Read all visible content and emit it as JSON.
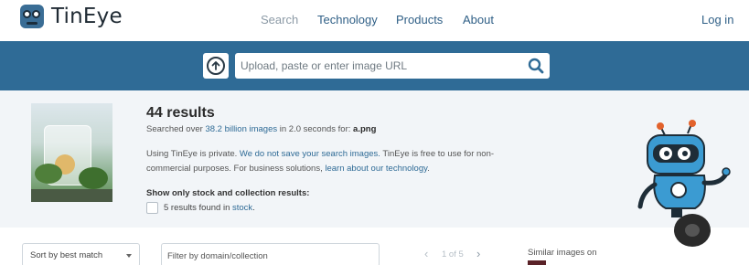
{
  "brand": {
    "name": "TinEye",
    "logo_icon": "tineye-logo-icon"
  },
  "nav": {
    "items": [
      {
        "label": "Search"
      },
      {
        "label": "Technology"
      },
      {
        "label": "Products"
      },
      {
        "label": "About"
      }
    ],
    "login_label": "Log in"
  },
  "search": {
    "placeholder": "Upload, paste or enter image URL",
    "upload_icon": "upload-arrow-icon",
    "search_icon": "magnifier-icon",
    "band_color": "#2f6b96"
  },
  "results": {
    "title": "44 results",
    "searched_prefix": "Searched over ",
    "searched_count": "38.2 billion images",
    "searched_middle": " in 2.0 seconds for: ",
    "searched_file": "a.png",
    "privacy_1": "Using TinEye is private. ",
    "privacy_2": "We do not save your search images.",
    "privacy_3": " TinEye is free to use for non-commercial purposes. For business solutions, ",
    "privacy_4": "learn about our technology",
    "privacy_5": ".",
    "stock_label": "Show only stock and collection results:",
    "stock_count": "5 results found in ",
    "stock_link": "stock",
    "stock_end": "."
  },
  "controls": {
    "sort_label": "Sort by best match",
    "filter_placeholder": "Filter by domain/collection",
    "pager_text": "1 of 5",
    "similar_label": "Similar images on"
  }
}
